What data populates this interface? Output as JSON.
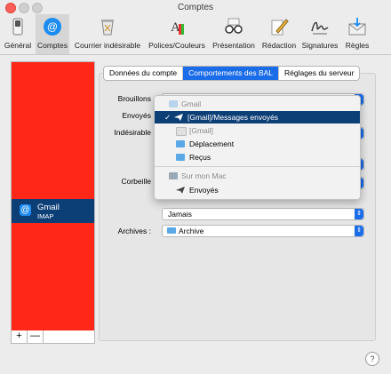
{
  "window": {
    "title": "Comptes"
  },
  "toolbar": {
    "items": [
      {
        "label": "Général",
        "icon": "switch-icon"
      },
      {
        "label": "Comptes",
        "icon": "at-icon"
      },
      {
        "label": "Courrier indésirable",
        "icon": "trash-junk-icon"
      },
      {
        "label": "Polices/Couleurs",
        "icon": "fonts-colors-icon"
      },
      {
        "label": "Présentation",
        "icon": "glasses-icon"
      },
      {
        "label": "Rédaction",
        "icon": "pen-paper-icon"
      },
      {
        "label": "Signatures",
        "icon": "signature-icon"
      },
      {
        "label": "Règles",
        "icon": "rules-envelope-icon"
      }
    ],
    "active": "Comptes"
  },
  "accounts": {
    "items": [
      {
        "name": "Gmail",
        "type": "IMAP",
        "icon": "at-icon"
      }
    ],
    "list_color": "#ff2717",
    "add_label": "+",
    "remove_label": "—"
  },
  "tabs": [
    {
      "label": "Données du compte",
      "selected": false
    },
    {
      "label": "Comportements des BAL",
      "selected": true
    },
    {
      "label": "Réglages du serveur",
      "selected": false
    }
  ],
  "form": {
    "drafts_label": "Brouillons",
    "sent_label": "Envoyés",
    "junk_label": "Indésirable",
    "trash_label": "Corbeille",
    "archive_label": "Archives :",
    "erase_value": "Jamais",
    "archive_value": "Archive"
  },
  "menu": {
    "section1": "Gmail",
    "items": [
      {
        "label": "[Gmail]/Messages envoyés",
        "selected": true,
        "checked": "✓"
      },
      {
        "label": "[Gmail]",
        "dim": true
      },
      {
        "label": "Déplacement"
      },
      {
        "label": "Reçus"
      }
    ],
    "section2": "Sur mon Mac",
    "mac_items": [
      {
        "label": "Envoyés"
      }
    ]
  },
  "help_label": "?"
}
